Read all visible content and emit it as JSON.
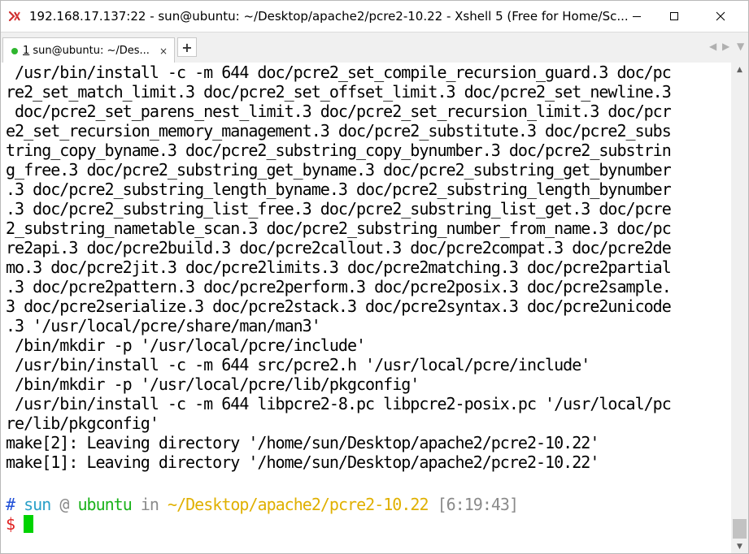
{
  "window": {
    "title": "192.168.17.137:22 - sun@ubuntu: ~/Desktop/apache2/pcre2-10.22 - Xshell 5 (Free for Home/Sc..."
  },
  "controls": {
    "minimize_icon": "minimize-icon",
    "maximize_icon": "maximize-icon",
    "close_icon": "close-icon"
  },
  "tabs": [
    {
      "number": "1",
      "label": " sun@ubuntu: ~/Des...",
      "status_color": "#2fb62f"
    }
  ],
  "tab_close": "×",
  "tab_add": "+",
  "tab_nav": {
    "prev": "◀",
    "next": "▶",
    "menu": "▼"
  },
  "terminal": {
    "lines": [
      " /usr/bin/install -c -m 644 doc/pcre2_set_compile_recursion_guard.3 doc/pc",
      "re2_set_match_limit.3 doc/pcre2_set_offset_limit.3 doc/pcre2_set_newline.3",
      " doc/pcre2_set_parens_nest_limit.3 doc/pcre2_set_recursion_limit.3 doc/pcr",
      "e2_set_recursion_memory_management.3 doc/pcre2_substitute.3 doc/pcre2_subs",
      "tring_copy_byname.3 doc/pcre2_substring_copy_bynumber.3 doc/pcre2_substrin",
      "g_free.3 doc/pcre2_substring_get_byname.3 doc/pcre2_substring_get_bynumber",
      ".3 doc/pcre2_substring_length_byname.3 doc/pcre2_substring_length_bynumber",
      ".3 doc/pcre2_substring_list_free.3 doc/pcre2_substring_list_get.3 doc/pcre",
      "2_substring_nametable_scan.3 doc/pcre2_substring_number_from_name.3 doc/pc",
      "re2api.3 doc/pcre2build.3 doc/pcre2callout.3 doc/pcre2compat.3 doc/pcre2de",
      "mo.3 doc/pcre2jit.3 doc/pcre2limits.3 doc/pcre2matching.3 doc/pcre2partial",
      ".3 doc/pcre2pattern.3 doc/pcre2perform.3 doc/pcre2posix.3 doc/pcre2sample.",
      "3 doc/pcre2serialize.3 doc/pcre2stack.3 doc/pcre2syntax.3 doc/pcre2unicode",
      ".3 '/usr/local/pcre/share/man/man3'",
      " /bin/mkdir -p '/usr/local/pcre/include'",
      " /usr/bin/install -c -m 644 src/pcre2.h '/usr/local/pcre/include'",
      " /bin/mkdir -p '/usr/local/pcre/lib/pkgconfig'",
      " /usr/bin/install -c -m 644 libpcre2-8.pc libpcre2-posix.pc '/usr/local/pc",
      "re/lib/pkgconfig'",
      "make[2]: Leaving directory '/home/sun/Desktop/apache2/pcre2-10.22'",
      "make[1]: Leaving directory '/home/sun/Desktop/apache2/pcre2-10.22'"
    ],
    "prompt": {
      "hash": "#",
      "user": "sun",
      "at": "@",
      "host": "ubuntu",
      "in": "in",
      "path": "~/Desktop/apache2/pcre2-10.22",
      "time": "[6:19:43]",
      "dollar": "$"
    },
    "colors": {
      "cursor": "#00d300",
      "hash": "#1f4fd8",
      "user": "#2aa0c8",
      "host": "#19b219",
      "path": "#e0b000",
      "dollar": "#e02020"
    }
  }
}
